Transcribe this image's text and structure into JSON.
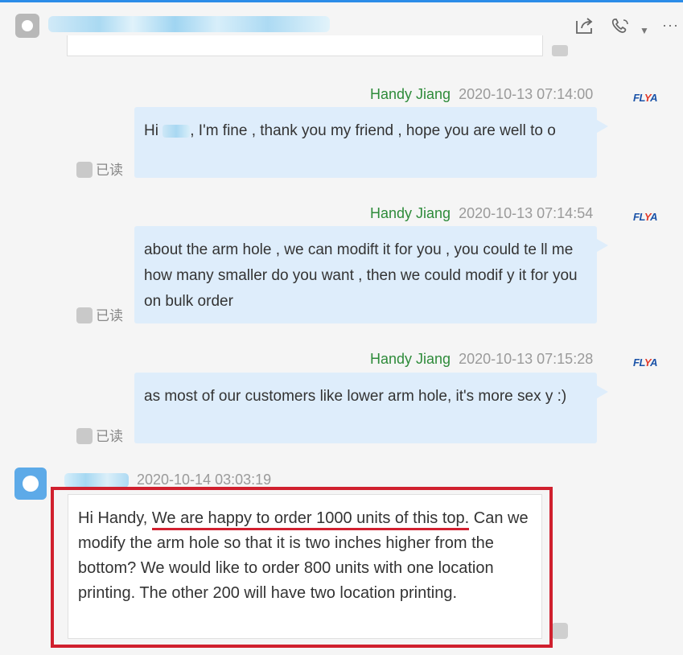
{
  "header": {
    "share_icon": "share-icon",
    "call_icon": "phone-icon",
    "dropdown_icon": "chevron-down-icon",
    "more_glyph": "···"
  },
  "logo_text": "FLYA",
  "read_label": "已读",
  "messages": [
    {
      "sender": "Handy Jiang",
      "time": "2020-10-13 07:14:00",
      "text_before_name": "Hi ",
      "text": ", I'm fine , thank you my friend , hope you are well to o"
    },
    {
      "sender": "Handy Jiang",
      "time": "2020-10-13 07:14:54",
      "text": "about the arm hole , we can modift it for you , you could te ll me how many smaller do you want , then we could modif y it for you on bulk order"
    },
    {
      "sender": "Handy Jiang",
      "time": "2020-10-13 07:15:28",
      "text": "as most of our customers like lower arm hole, it's more sex y :)"
    }
  ],
  "incoming": {
    "time": "2020-10-14 03:03:19",
    "text_start": "Hi Handy, ",
    "text_highlight": "We are happy to order 1000 units of this top.",
    "text_rest": " Can we modify the arm hole so that it is two inches higher from the bottom? We would like to order 800 units with one location printing. The other 200 will have two location printing."
  },
  "colors": {
    "sender_green": "#2e8b3a",
    "bubble_blue": "#deedfb",
    "highlight_red": "#d0202e"
  }
}
